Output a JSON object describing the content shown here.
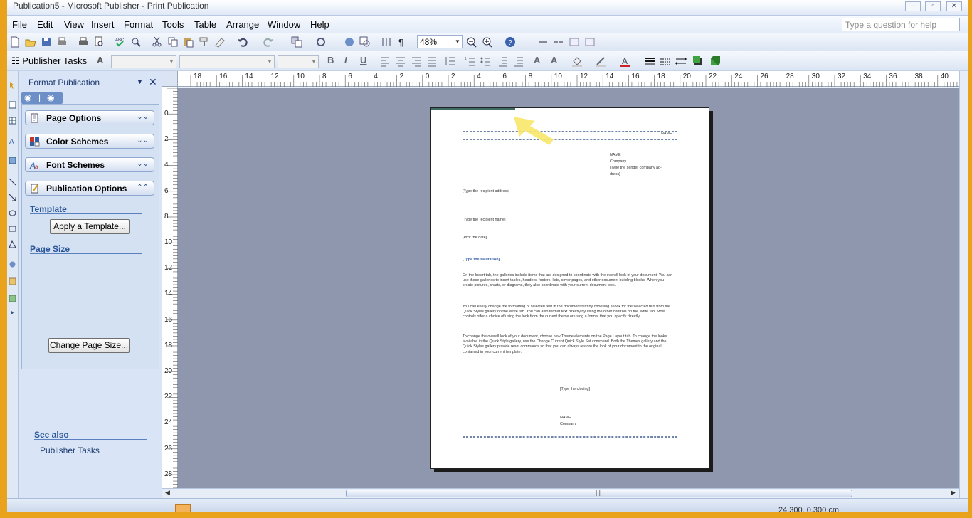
{
  "window": {
    "title": "Publication5 - Microsoft Publisher - Print Publication"
  },
  "menu": {
    "items": [
      "File",
      "Edit",
      "View",
      "Insert",
      "Format",
      "Tools",
      "Table",
      "Arrange",
      "Window",
      "Help"
    ],
    "help_placeholder": "Type a question for help"
  },
  "toolbar": {
    "zoom": "48%",
    "publisher_tasks": "Publisher Tasks"
  },
  "taskpane": {
    "title": "Format Publication",
    "sections": [
      {
        "label": "Page Options",
        "expanded": false
      },
      {
        "label": "Color Schemes",
        "expanded": false
      },
      {
        "label": "Font Schemes",
        "expanded": false
      },
      {
        "label": "Publication Options",
        "expanded": true
      }
    ],
    "template_head": "Template",
    "apply_template": "Apply a Template...",
    "page_size_head": "Page Size",
    "change_page_size": "Change Page Size...",
    "see_also_head": "See also",
    "see_also_link": "Publisher Tasks"
  },
  "ruler": {
    "top": [
      "18",
      "16",
      "14",
      "12",
      "10",
      "8",
      "6",
      "4",
      "2",
      "0",
      "2",
      "4",
      "6",
      "8",
      "10",
      "12",
      "14",
      "16",
      "18",
      "20",
      "22",
      "24",
      "26",
      "28",
      "30",
      "32",
      "34",
      "36",
      "38",
      "40"
    ],
    "left": [
      "0",
      "2",
      "4",
      "6",
      "8",
      "10",
      "12",
      "14",
      "16",
      "18",
      "20",
      "22",
      "24",
      "26",
      "28"
    ]
  },
  "document": {
    "header_name": "NAME",
    "sender_name": "NAME",
    "sender_company": "Company",
    "sender_address_1": "[Type the sender company ad-",
    "sender_address_2": "dress]",
    "recipient_address": "[Type the recipient address]",
    "recipient_name": "[Type the recipient name]",
    "date": "[Pick the date]",
    "salutation": "[Type the salutation]",
    "para1": "On the Insert tab, the galleries include items that are designed to coordinate with the overall look of your document. You can use these galleries to insert tables, headers, footers, lists, cover pages, and other document building blocks. When you create pictures, charts, or diagrams, they also coordinate with your current document look.",
    "para2": "You can easily change the formatting of selected text in the document text by choosing a look for the selected text from the Quick Styles gallery on the Write tab. You can also format text directly by using the other controls on the Write tab. Most controls offer a choice of using the look from the current theme or using a format that you specify directly.",
    "para3": "To change the overall look of your document, choose new Theme elements on the Page Layout tab. To change the looks available in the Quick Style gallery, use the Change Current Quick Style Set command. Both the Themes gallery and the Quick Styles gallery provide reset commands so that you can always restore the look of your document to the original contained in your current template.",
    "closing": "[Type the closing]",
    "closing_name": "NAME",
    "closing_company": "Company"
  },
  "status": {
    "position": "24.300, 0.300 cm"
  },
  "colors": {
    "accent": "#3c67a8",
    "workspace": "#8e97ae",
    "pointer": "#f7e76a"
  }
}
